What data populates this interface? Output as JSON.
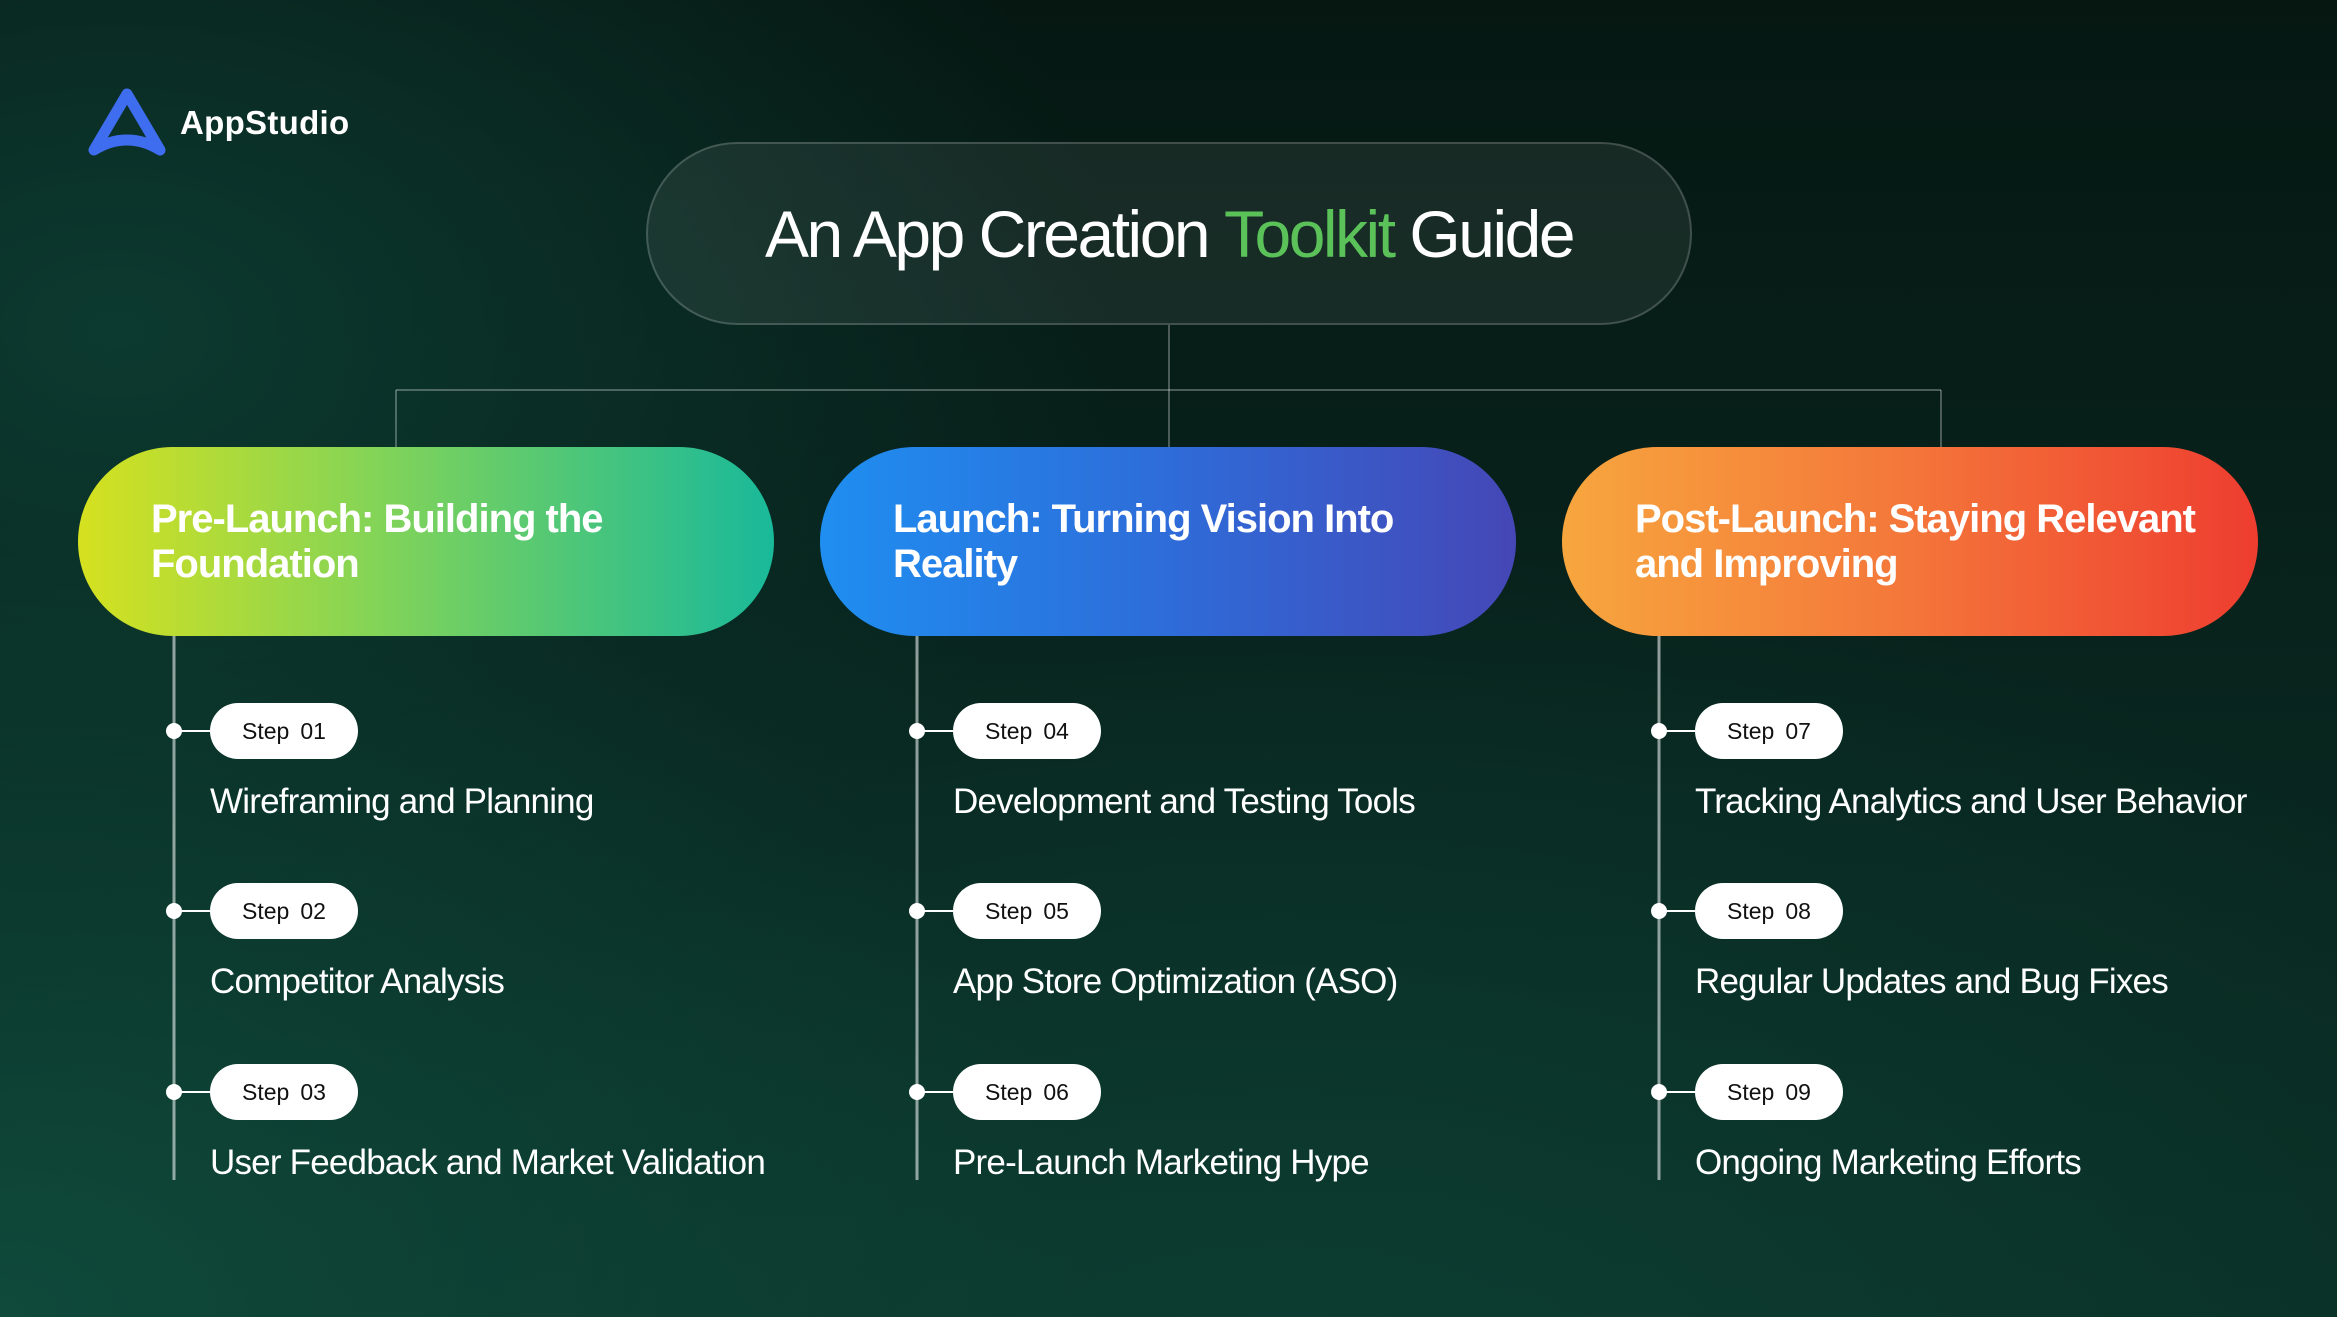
{
  "brand": {
    "name": "AppStudio",
    "logo_icon": "triangle-a-icon",
    "logo_color": "#3f6df0"
  },
  "title": {
    "before": "An App Creation",
    "accent": "Toolkit",
    "after": "Guide",
    "accent_color": "#5bc25a"
  },
  "phases": [
    {
      "title": "Pre-Launch: Building the Foundation",
      "gradient": [
        "#d6e11f",
        "#7fd35a",
        "#19b99a"
      ],
      "steps": [
        {
          "word": "Step",
          "number": "01",
          "text": "Wireframing and Planning"
        },
        {
          "word": "Step",
          "number": "02",
          "text": "Competitor Analysis"
        },
        {
          "word": "Step",
          "number": "03",
          "text": "User Feedback and Market Validation"
        }
      ]
    },
    {
      "title": "Launch: Turning Vision Into Reality",
      "gradient": [
        "#1f8ef0",
        "#2e6cd9",
        "#4547b6"
      ],
      "steps": [
        {
          "word": "Step",
          "number": "04",
          "text": "Development and Testing Tools"
        },
        {
          "word": "Step",
          "number": "05",
          "text": "App Store Optimization (ASO)"
        },
        {
          "word": "Step",
          "number": "06",
          "text": "Pre-Launch Marketing Hype"
        }
      ]
    },
    {
      "title": "Post-Launch: Staying Relevant and Improving",
      "gradient": [
        "#f7a63e",
        "#f4763a",
        "#ee3d30"
      ],
      "steps": [
        {
          "word": "Step",
          "number": "07",
          "text": "Tracking Analytics and User Behavior"
        },
        {
          "word": "Step",
          "number": "08",
          "text": "Regular Updates and Bug Fixes"
        },
        {
          "word": "Step",
          "number": "09",
          "text": "Ongoing Marketing Efforts"
        }
      ]
    }
  ]
}
